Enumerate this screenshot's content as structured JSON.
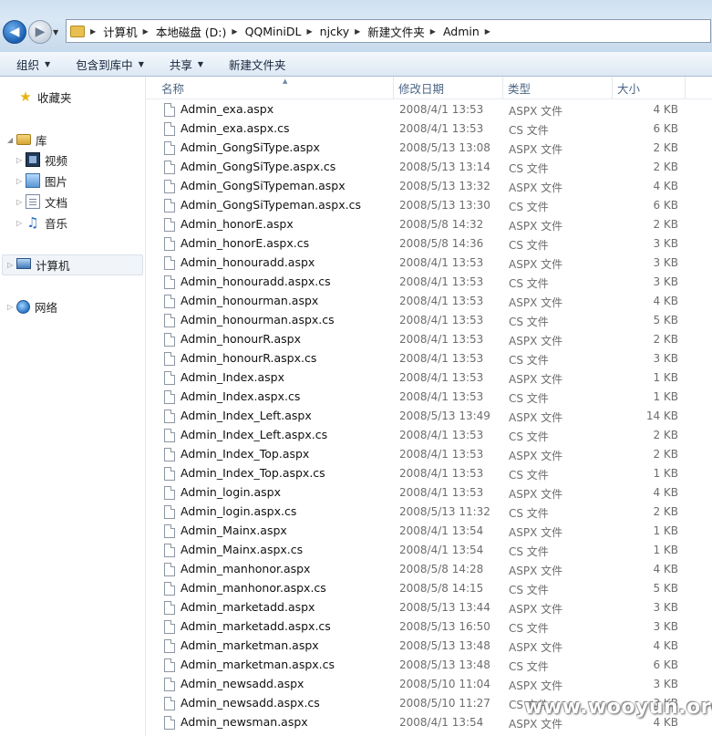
{
  "address": {
    "crumbs": [
      "计算机",
      "本地磁盘 (D:)",
      "QQMiniDL",
      "njcky",
      "新建文件夹",
      "Admin"
    ]
  },
  "toolbar": {
    "organize": "组织",
    "include_library": "包含到库中",
    "share": "共享",
    "new_folder": "新建文件夹"
  },
  "nav": {
    "favorites": "收藏夹",
    "libraries": "库",
    "videos": "视频",
    "pictures": "图片",
    "documents": "文档",
    "music": "音乐",
    "computer": "计算机",
    "network": "网络"
  },
  "columns": {
    "name": "名称",
    "date": "修改日期",
    "type": "类型",
    "size": "大小"
  },
  "files": [
    {
      "name": "Admin_exa.aspx",
      "date": "2008/4/1 13:53",
      "type": "ASPX 文件",
      "size": "4 KB"
    },
    {
      "name": "Admin_exa.aspx.cs",
      "date": "2008/4/1 13:53",
      "type": "CS 文件",
      "size": "6 KB"
    },
    {
      "name": "Admin_GongSiType.aspx",
      "date": "2008/5/13 13:08",
      "type": "ASPX 文件",
      "size": "2 KB"
    },
    {
      "name": "Admin_GongSiType.aspx.cs",
      "date": "2008/5/13 13:14",
      "type": "CS 文件",
      "size": "2 KB"
    },
    {
      "name": "Admin_GongSiTypeman.aspx",
      "date": "2008/5/13 13:32",
      "type": "ASPX 文件",
      "size": "4 KB"
    },
    {
      "name": "Admin_GongSiTypeman.aspx.cs",
      "date": "2008/5/13 13:30",
      "type": "CS 文件",
      "size": "6 KB"
    },
    {
      "name": "Admin_honorE.aspx",
      "date": "2008/5/8 14:32",
      "type": "ASPX 文件",
      "size": "2 KB"
    },
    {
      "name": "Admin_honorE.aspx.cs",
      "date": "2008/5/8 14:36",
      "type": "CS 文件",
      "size": "3 KB"
    },
    {
      "name": "Admin_honouradd.aspx",
      "date": "2008/4/1 13:53",
      "type": "ASPX 文件",
      "size": "3 KB"
    },
    {
      "name": "Admin_honouradd.aspx.cs",
      "date": "2008/4/1 13:53",
      "type": "CS 文件",
      "size": "3 KB"
    },
    {
      "name": "Admin_honourman.aspx",
      "date": "2008/4/1 13:53",
      "type": "ASPX 文件",
      "size": "4 KB"
    },
    {
      "name": "Admin_honourman.aspx.cs",
      "date": "2008/4/1 13:53",
      "type": "CS 文件",
      "size": "5 KB"
    },
    {
      "name": "Admin_honourR.aspx",
      "date": "2008/4/1 13:53",
      "type": "ASPX 文件",
      "size": "2 KB"
    },
    {
      "name": "Admin_honourR.aspx.cs",
      "date": "2008/4/1 13:53",
      "type": "CS 文件",
      "size": "3 KB"
    },
    {
      "name": "Admin_Index.aspx",
      "date": "2008/4/1 13:53",
      "type": "ASPX 文件",
      "size": "1 KB"
    },
    {
      "name": "Admin_Index.aspx.cs",
      "date": "2008/4/1 13:53",
      "type": "CS 文件",
      "size": "1 KB"
    },
    {
      "name": "Admin_Index_Left.aspx",
      "date": "2008/5/13 13:49",
      "type": "ASPX 文件",
      "size": "14 KB"
    },
    {
      "name": "Admin_Index_Left.aspx.cs",
      "date": "2008/4/1 13:53",
      "type": "CS 文件",
      "size": "2 KB"
    },
    {
      "name": "Admin_Index_Top.aspx",
      "date": "2008/4/1 13:53",
      "type": "ASPX 文件",
      "size": "2 KB"
    },
    {
      "name": "Admin_Index_Top.aspx.cs",
      "date": "2008/4/1 13:53",
      "type": "CS 文件",
      "size": "1 KB"
    },
    {
      "name": "Admin_login.aspx",
      "date": "2008/4/1 13:53",
      "type": "ASPX 文件",
      "size": "4 KB"
    },
    {
      "name": "Admin_login.aspx.cs",
      "date": "2008/5/13 11:32",
      "type": "CS 文件",
      "size": "2 KB"
    },
    {
      "name": "Admin_Mainx.aspx",
      "date": "2008/4/1 13:54",
      "type": "ASPX 文件",
      "size": "1 KB"
    },
    {
      "name": "Admin_Mainx.aspx.cs",
      "date": "2008/4/1 13:54",
      "type": "CS 文件",
      "size": "1 KB"
    },
    {
      "name": "Admin_manhonor.aspx",
      "date": "2008/5/8 14:28",
      "type": "ASPX 文件",
      "size": "4 KB"
    },
    {
      "name": "Admin_manhonor.aspx.cs",
      "date": "2008/5/8 14:15",
      "type": "CS 文件",
      "size": "5 KB"
    },
    {
      "name": "Admin_marketadd.aspx",
      "date": "2008/5/13 13:44",
      "type": "ASPX 文件",
      "size": "3 KB"
    },
    {
      "name": "Admin_marketadd.aspx.cs",
      "date": "2008/5/13 16:50",
      "type": "CS 文件",
      "size": "3 KB"
    },
    {
      "name": "Admin_marketman.aspx",
      "date": "2008/5/13 13:48",
      "type": "ASPX 文件",
      "size": "4 KB"
    },
    {
      "name": "Admin_marketman.aspx.cs",
      "date": "2008/5/13 13:48",
      "type": "CS 文件",
      "size": "6 KB"
    },
    {
      "name": "Admin_newsadd.aspx",
      "date": "2008/5/10 11:04",
      "type": "ASPX 文件",
      "size": "3 KB"
    },
    {
      "name": "Admin_newsadd.aspx.cs",
      "date": "2008/5/10 11:27",
      "type": "CS 文件",
      "size": "3 KB"
    },
    {
      "name": "Admin_newsman.aspx",
      "date": "2008/4/1 13:54",
      "type": "ASPX 文件",
      "size": "4 KB"
    }
  ],
  "watermark": "www.wooyun.org"
}
